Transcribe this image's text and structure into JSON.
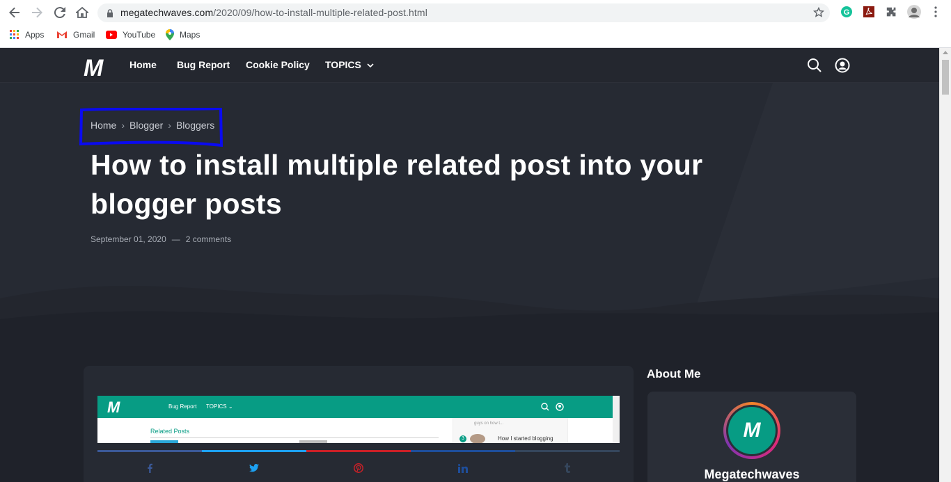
{
  "browser": {
    "url_host": "megatechwaves.com",
    "url_path": "/2020/09/how-to-install-multiple-related-post.html",
    "bookmarks": [
      {
        "label": "Apps",
        "icon": "apps-grid-icon"
      },
      {
        "label": "Gmail",
        "icon": "gmail-icon"
      },
      {
        "label": "YouTube",
        "icon": "youtube-icon"
      },
      {
        "label": "Maps",
        "icon": "maps-icon"
      }
    ]
  },
  "site": {
    "logo": "M",
    "nav": [
      "Home",
      "Bug Report",
      "Cookie Policy",
      "TOPICS"
    ]
  },
  "breadcrumb": [
    "Home",
    "Blogger",
    "Bloggers"
  ],
  "post": {
    "title": "How to install multiple related post into your blogger posts",
    "date": "September 01, 2020",
    "separator": "—",
    "comments": "2 comments"
  },
  "thumbnail": {
    "logo": "M",
    "nav": [
      "Bug Report",
      "TOPICS ⌄"
    ],
    "related_label": "Related Posts",
    "side_number": "3",
    "side_title": "How I started blogging",
    "side_snippet": "guys on how t..."
  },
  "share": {
    "colors": [
      "#3b5998",
      "#1da1f2",
      "#cb2027",
      "#1e4e9b",
      "#35465c"
    ],
    "icons": [
      "f",
      "twitter",
      "pinterest",
      "in",
      "t"
    ]
  },
  "sidebar": {
    "heading": "About Me",
    "avatar_letter": "M",
    "name": "Megatechwaves"
  }
}
